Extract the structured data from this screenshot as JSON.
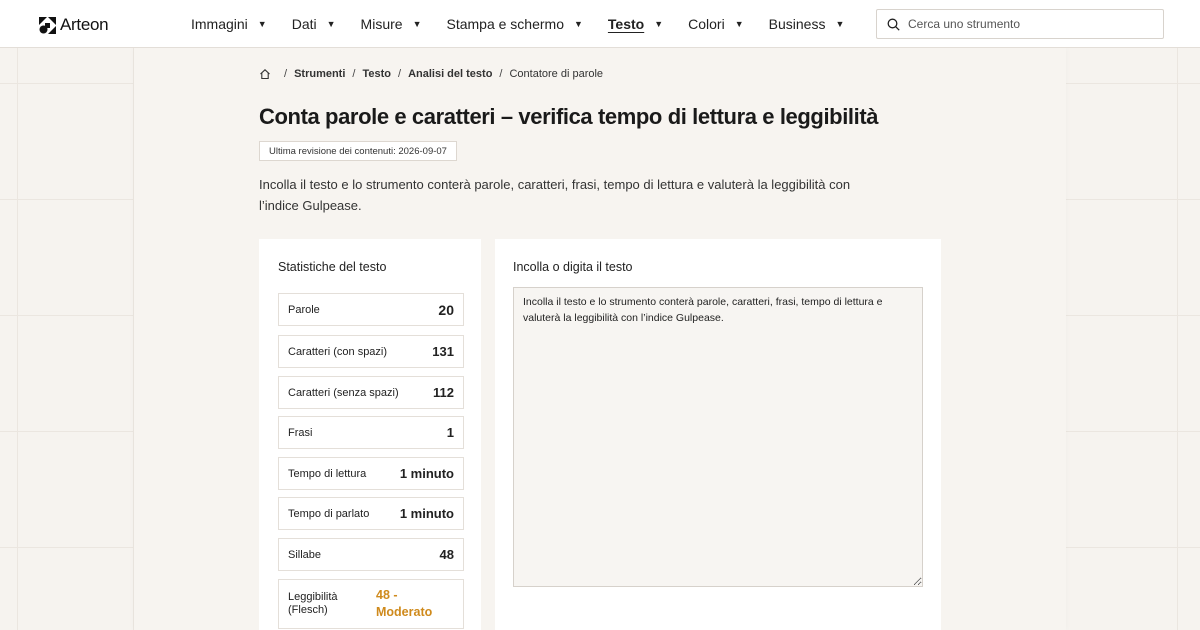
{
  "brand": {
    "name": "Arteon"
  },
  "nav": [
    {
      "label": "Immagini",
      "active": false
    },
    {
      "label": "Dati",
      "active": false
    },
    {
      "label": "Misure",
      "active": false
    },
    {
      "label": "Stampa e schermo",
      "active": false
    },
    {
      "label": "Testo",
      "active": true
    },
    {
      "label": "Colori",
      "active": false
    },
    {
      "label": "Business",
      "active": false
    }
  ],
  "search": {
    "placeholder": "Cerca uno strumento",
    "icon": "search-icon"
  },
  "breadcrumb": {
    "items": [
      "Strumenti",
      "Testo",
      "Analisi del testo"
    ],
    "current": "Contatore di parole",
    "separator": "/"
  },
  "page": {
    "title": "Conta parole e caratteri – verifica tempo di lettura e leggibilità",
    "revision": "Ultima revisione dei contenuti: 2026-09-07",
    "intro": "Incolla il testo e lo strumento conterà parole, caratteri, frasi, tempo di lettura e valuterà la leggibilità con l’indice Gulpease."
  },
  "stats": {
    "title": "Statistiche del testo",
    "rows": [
      {
        "label": "Parole",
        "value": "20"
      },
      {
        "label": "Caratteri (con spazi)",
        "value": "131"
      },
      {
        "label": "Caratteri (senza spazi)",
        "value": "112"
      },
      {
        "label": "Frasi",
        "value": "1"
      },
      {
        "label": "Tempo di lettura",
        "value": "1 minuto"
      },
      {
        "label": "Tempo di parlato",
        "value": "1 minuto"
      },
      {
        "label": "Sillabe",
        "value": "48"
      },
      {
        "label": "Leggibilità (Flesch)",
        "value": "48 - Moderato"
      }
    ]
  },
  "editor": {
    "title": "Incolla o digita il testo",
    "value": "Incolla il testo e lo strumento conterà parole, caratteri, frasi, tempo di lettura e valuterà la leggibilità con l’indice Gulpease."
  },
  "colors": {
    "accent": "#cf8a1c",
    "background": "#f6f3ef"
  }
}
